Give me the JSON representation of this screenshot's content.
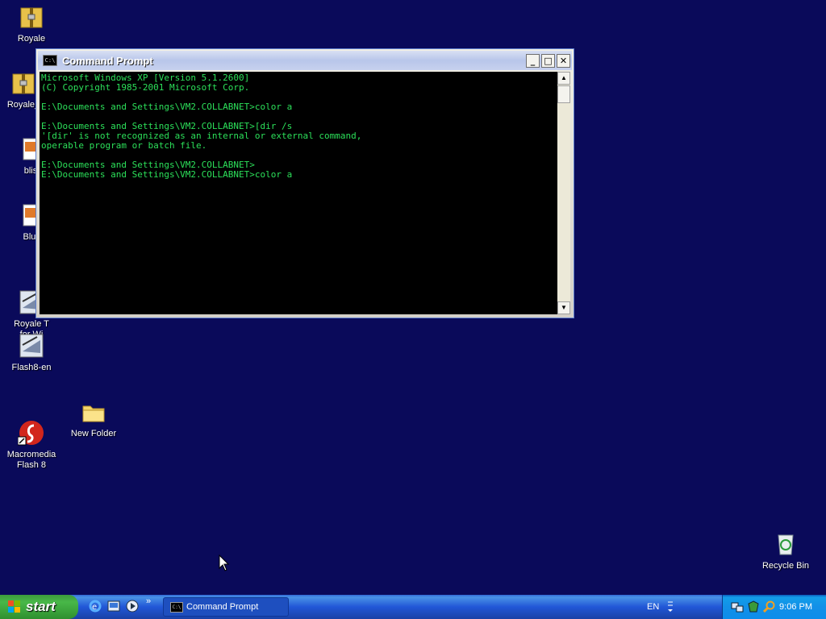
{
  "desktop": {
    "icons": [
      {
        "label": "Royale",
        "icon": "zip-folder-icon"
      },
      {
        "label": "Royale_",
        "icon": "zip-folder-icon"
      },
      {
        "label": "blis",
        "icon": "image-file-icon"
      },
      {
        "label": "Bluf",
        "icon": "image-file-icon"
      },
      {
        "label": "Royale T\nfor Wi",
        "icon": "installer-icon"
      },
      {
        "label": "Flash8-en",
        "icon": "installer-icon"
      },
      {
        "label": "Macromedia\nFlash 8",
        "icon": "flash-icon"
      },
      {
        "label": "New Folder",
        "icon": "folder-icon"
      },
      {
        "label": "Recycle Bin",
        "icon": "recycle-bin-icon"
      }
    ]
  },
  "window": {
    "title": "Command Prompt",
    "icon_text": "C:\\",
    "console_lines": [
      "Microsoft Windows XP [Version 5.1.2600]",
      "(C) Copyright 1985-2001 Microsoft Corp.",
      "",
      "E:\\Documents and Settings\\VM2.COLLABNET>color a",
      "",
      "E:\\Documents and Settings\\VM2.COLLABNET>[dir /s",
      "'[dir' is not recognized as an internal or external command,",
      "operable program or batch file.",
      "",
      "E:\\Documents and Settings\\VM2.COLLABNET>",
      "E:\\Documents and Settings\\VM2.COLLABNET>color a"
    ],
    "text_color": "#2ce05a"
  },
  "taskbar": {
    "start_label": "start",
    "task_label": "Command Prompt",
    "language": "EN",
    "clock": "9:06 PM",
    "quicklaunch_more": "»"
  }
}
